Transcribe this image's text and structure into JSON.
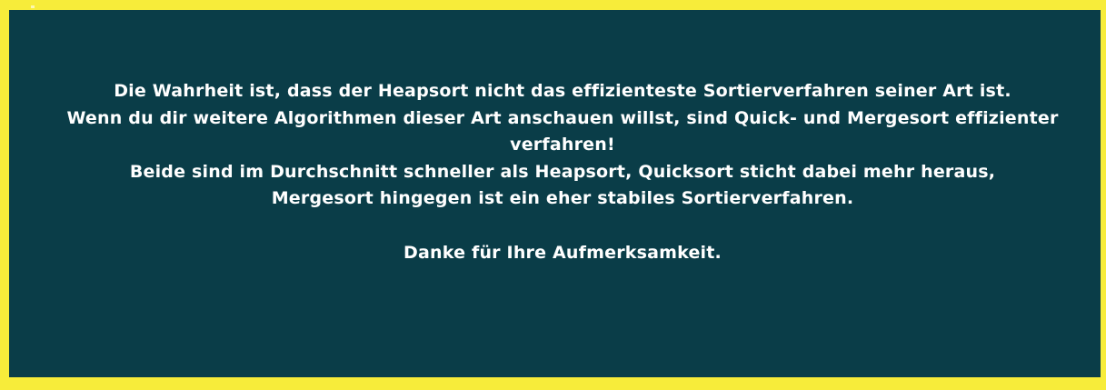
{
  "slide": {
    "lines": [
      "Die Wahrheit ist, dass der Heapsort nicht das effizienteste Sortierverfahren seiner Art ist.",
      "Wenn du dir weitere Algorithmen dieser Art anschauen willst, sind Quick- und Mergesort effizienter verfahren!",
      "Beide sind im Durchschnitt schneller als Heapsort, Quicksort sticht dabei mehr heraus,",
      "Mergesort hingegen ist ein eher stabiles Sortierverfahren."
    ],
    "closing": "Danke für Ihre Aufmerksamkeit."
  },
  "colors": {
    "border": "#f7ec3a",
    "background": "#0a3d48",
    "text": "#ffffff"
  }
}
